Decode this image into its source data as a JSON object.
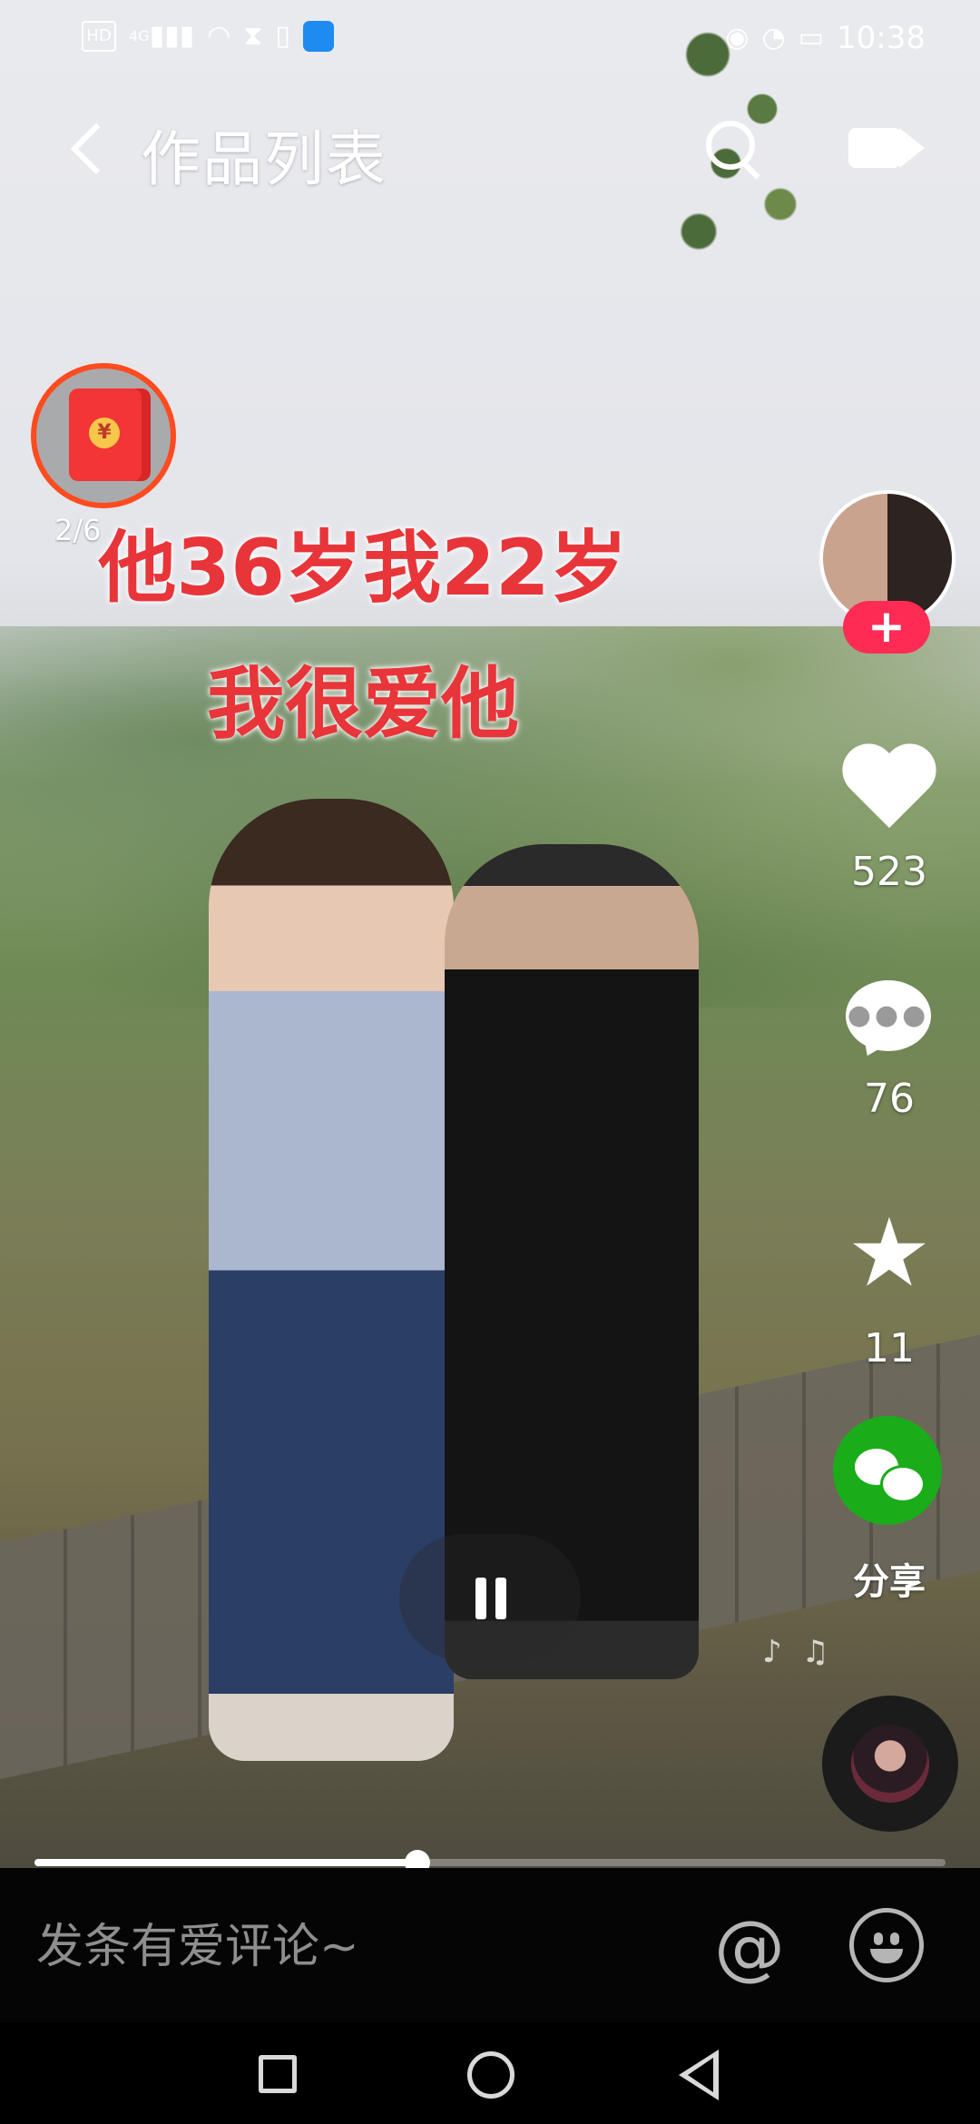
{
  "status_bar": {
    "hd_label": "HD",
    "network": "4G",
    "time": "10:38"
  },
  "header": {
    "title": "作品列表"
  },
  "video": {
    "caption_line1": "他36岁我22岁",
    "caption_line2": "我很爱他"
  },
  "red_packet": {
    "progress": "2/6",
    "coin_symbol": "¥"
  },
  "rail": {
    "follow_label": "+",
    "likes": "523",
    "comments": "76",
    "favorites": "11",
    "share_label": "分享"
  },
  "playback": {
    "progress_fraction": 0.42
  },
  "comment_bar": {
    "placeholder": "发条有爱评论~",
    "at_symbol": "@"
  },
  "icons": {
    "back": "back-chevron-icon",
    "search": "search-icon",
    "camera": "camera-icon",
    "heart": "heart-icon",
    "comment": "comment-bubble-icon",
    "star": "star-icon",
    "share": "wechat-icon",
    "pause": "pause-icon",
    "music": "music-disc-icon",
    "emoji": "emoji-icon"
  },
  "colors": {
    "follow_red": "#fe2c55",
    "caption_red": "#e8353a",
    "wechat_green": "#1aad19",
    "packet_ring": "#ff4b1f"
  }
}
